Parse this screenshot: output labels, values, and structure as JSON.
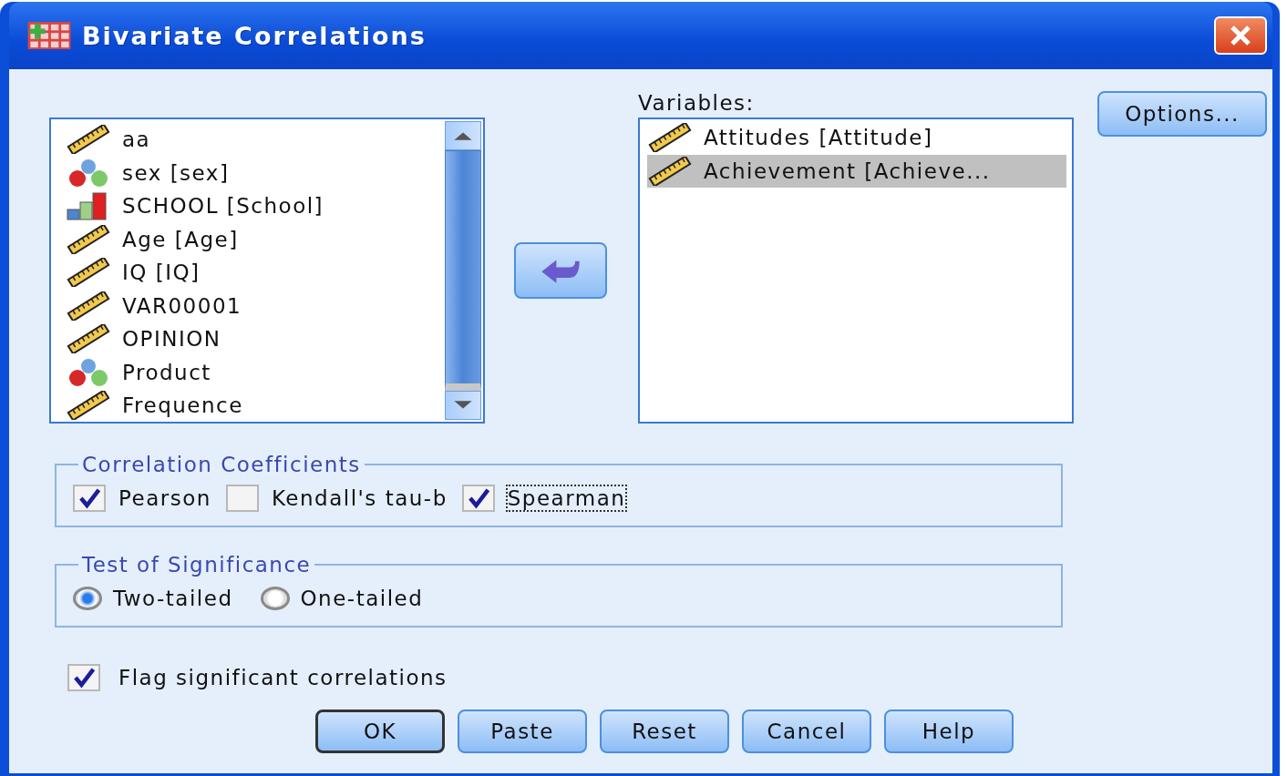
{
  "window": {
    "title": "Bivariate Correlations"
  },
  "source_list": {
    "items": [
      {
        "label": "aa",
        "kind": "scale",
        "selected": false
      },
      {
        "label": "sex [sex]",
        "kind": "nominal",
        "selected": false
      },
      {
        "label": "SCHOOL [School]",
        "kind": "ordinal",
        "selected": false
      },
      {
        "label": "Age [Age]",
        "kind": "scale",
        "selected": false
      },
      {
        "label": "IQ [IQ]",
        "kind": "scale",
        "selected": false
      },
      {
        "label": "VAR00001",
        "kind": "scale",
        "selected": false
      },
      {
        "label": "OPINION",
        "kind": "scale",
        "selected": false
      },
      {
        "label": "Product",
        "kind": "nominal",
        "selected": false
      },
      {
        "label": "Frequence",
        "kind": "scale",
        "selected": false
      }
    ]
  },
  "variables": {
    "label": "Variables:",
    "items": [
      {
        "label": "Attitudes [Attitude]",
        "kind": "scale",
        "selected": false
      },
      {
        "label": "Achievement [Achieve...",
        "kind": "scale",
        "selected": true
      }
    ]
  },
  "options_button": "Options...",
  "correlation_coefficients": {
    "title": "Correlation Coefficients",
    "options": [
      {
        "label": "Pearson",
        "checked": true,
        "focused": false
      },
      {
        "label": "Kendall's tau-b",
        "checked": false,
        "focused": false
      },
      {
        "label": "Spearman",
        "checked": true,
        "focused": true
      }
    ]
  },
  "test_of_significance": {
    "title": "Test of Significance",
    "options": [
      {
        "label": "Two-tailed",
        "selected": true
      },
      {
        "label": "One-tailed",
        "selected": false
      }
    ]
  },
  "flag_significant": {
    "label": "Flag significant correlations",
    "checked": true
  },
  "buttons": [
    {
      "label": "OK",
      "default": true
    },
    {
      "label": "Paste",
      "default": false
    },
    {
      "label": "Reset",
      "default": false
    },
    {
      "label": "Cancel",
      "default": false
    },
    {
      "label": "Help",
      "default": false
    }
  ]
}
